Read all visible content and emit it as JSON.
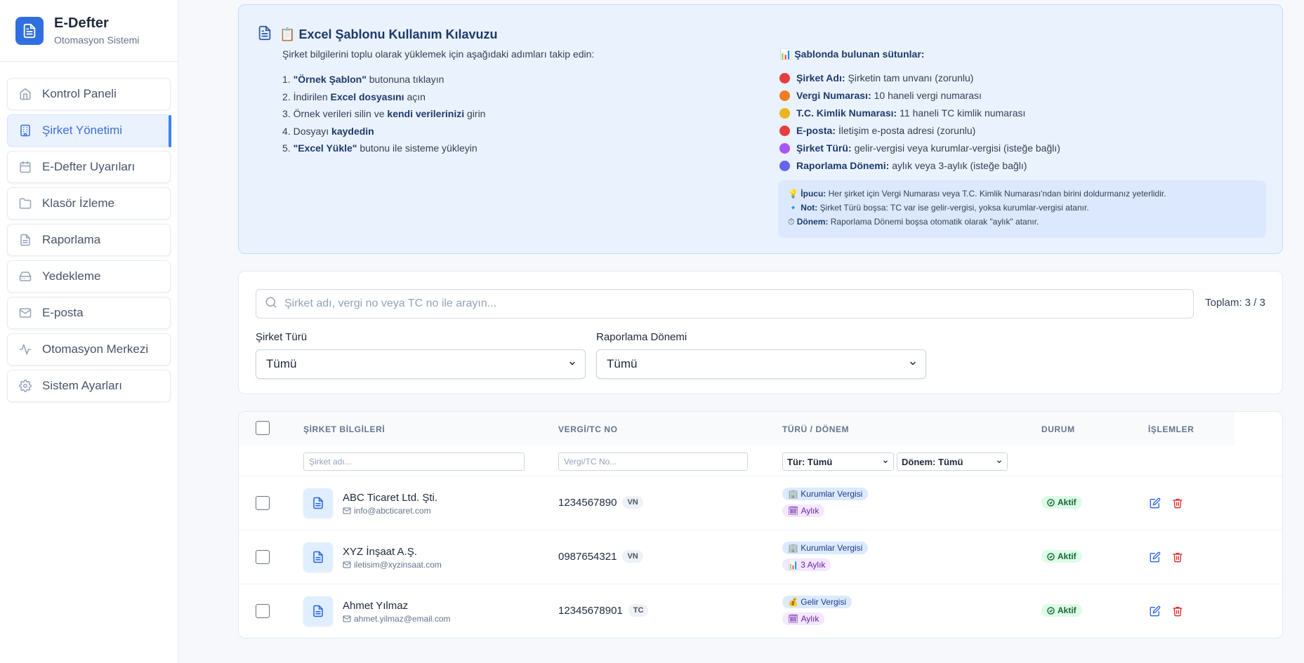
{
  "brand": {
    "title": "E-Defter",
    "subtitle": "Otomasyon Sistemi"
  },
  "sidebar": {
    "items": [
      {
        "label": "Kontrol Paneli",
        "icon": "home-icon"
      },
      {
        "label": "Şirket Yönetimi",
        "icon": "building-icon",
        "active": true
      },
      {
        "label": "E-Defter Uyarıları",
        "icon": "calendar-icon"
      },
      {
        "label": "Klasör İzleme",
        "icon": "folder-icon"
      },
      {
        "label": "Raporlama",
        "icon": "file-icon"
      },
      {
        "label": "Yedekleme",
        "icon": "hard-drive-icon"
      },
      {
        "label": "E-posta",
        "icon": "mail-icon"
      },
      {
        "label": "Otomasyon Merkezi",
        "icon": "activity-icon"
      },
      {
        "label": "Sistem Ayarları",
        "icon": "gear-icon"
      }
    ]
  },
  "guide": {
    "emoji": "📋",
    "title": "Excel Şablonu Kullanım Kılavuzu",
    "intro": "Şirket bilgilerini toplu olarak yüklemek için aşağıdaki adımları takip edin:",
    "steps": [
      {
        "num": "1.",
        "bold": "\"Örnek Şablon\"",
        "pre": "",
        "post": " butonuna tıklayın"
      },
      {
        "num": "2.",
        "pre": "İndirilen ",
        "bold": "Excel dosyasını",
        "post": " açın"
      },
      {
        "num": "3.",
        "pre": "Örnek verileri silin ve ",
        "bold": "kendi verilerinizi",
        "post": " girin"
      },
      {
        "num": "4.",
        "pre": "Dosyayı ",
        "bold": "kaydedin",
        "post": ""
      },
      {
        "num": "5.",
        "pre": "",
        "bold": "\"Excel Yükle\"",
        "post": " butonu ile sisteme yükleyin"
      }
    ],
    "columns_title": "📊 Şablonda bulunan sütunlar:",
    "columns": [
      {
        "name": "Şirket Adı:",
        "desc": "Şirketin tam unvanı (zorunlu)",
        "color": "#e53e3e"
      },
      {
        "name": "Vergi Numarası:",
        "desc": "10 haneli vergi numarası",
        "color": "#f07c24"
      },
      {
        "name": "T.C. Kimlik Numarası:",
        "desc": "11 haneli TC kimlik numarası",
        "color": "#e9b520"
      },
      {
        "name": "E-posta:",
        "desc": "İletişim e-posta adresi (zorunlu)",
        "color": "#e53e3e"
      },
      {
        "name": "Şirket Türü:",
        "desc": "gelir-vergisi veya kurumlar-vergisi (isteğe bağlı)",
        "color": "#a855f7"
      },
      {
        "name": "Raporlama Dönemi:",
        "desc": "aylık veya 3-aylık (isteğe bağlı)",
        "color": "#6366f1"
      }
    ],
    "tips": [
      {
        "emoji": "💡",
        "bold": "İpucu:",
        "text": "Her şirket için Vergi Numarası veya T.C. Kimlik Numarası'ndan birini doldurmanız yeterlidir."
      },
      {
        "emoji": "🔹",
        "bold": "Not:",
        "text": "Şirket Türü boşsa: TC var ise gelir-vergisi, yoksa kurumlar-vergisi atanır."
      },
      {
        "emoji": "⏱",
        "bold": "Dönem:",
        "text": "Raporlama Dönemi boşsa otomatik olarak \"aylık\" atanır."
      }
    ]
  },
  "filters": {
    "search_placeholder": "Şirket adı, vergi no veya TC no ile arayın...",
    "total": "Toplam: 3 / 3",
    "type_label": "Şirket Türü",
    "type_value": "Tümü",
    "period_label": "Raporlama Dönemi",
    "period_value": "Tümü"
  },
  "table": {
    "headers": {
      "company": "ŞİRKET BİLGİLERİ",
      "tax": "VERGİ/TC NO",
      "type": "TÜRÜ / DÖNEM",
      "status": "DURUM",
      "actions": "İŞLEMLER"
    },
    "filter_company_placeholder": "Şirket adı...",
    "filter_tax_placeholder": "Vergi/TC No...",
    "filter_type": "Tür: Tümü",
    "filter_period": "Dönem: Tümü",
    "rows": [
      {
        "name": "ABC Ticaret Ltd. Şti.",
        "email": "info@abcticaret.com",
        "tax": "1234567890",
        "tax_tag": "VN",
        "type_emoji": "🏢",
        "type": "Kurumlar Vergisi",
        "period_emoji": "🗓",
        "period": "Aylık",
        "status": "Aktif"
      },
      {
        "name": "XYZ İnşaat A.Ş.",
        "email": "iletisim@xyzinsaat.com",
        "tax": "0987654321",
        "tax_tag": "VN",
        "type_emoji": "🏢",
        "type": "Kurumlar Vergisi",
        "period_emoji": "📊",
        "period": "3 Aylık",
        "status": "Aktif"
      },
      {
        "name": "Ahmet Yılmaz",
        "email": "ahmet.yilmaz@email.com",
        "tax": "12345678901",
        "tax_tag": "TC",
        "type_emoji": "💰",
        "type": "Gelir Vergisi",
        "period_emoji": "🗓",
        "period": "Aylık",
        "status": "Aktif"
      }
    ]
  },
  "colors": {
    "accent": "#3b82f6",
    "brand": "#2f6fe0",
    "status_green": "#166534",
    "delete_red": "#dc2626"
  }
}
